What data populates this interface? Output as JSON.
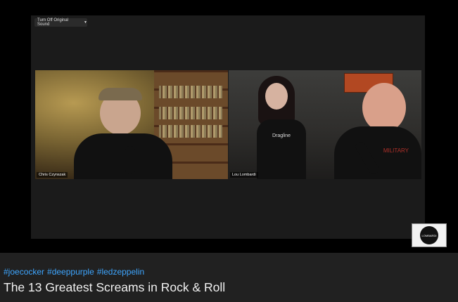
{
  "player": {
    "sound_button_label": "Turn Off Original Sound",
    "participants": [
      {
        "name": "Chris Czynszak"
      },
      {
        "name": "Lou Lombardi"
      }
    ],
    "logo_text": "LOMBARDI"
  },
  "video": {
    "hashtags": [
      "#joecocker",
      "#deeppurple",
      "#ledzeppelin"
    ],
    "title": "The 13 Greatest Screams in Rock & Roll"
  },
  "shirt_texts": {
    "woman": "Dragline",
    "man": "MILITARY"
  }
}
